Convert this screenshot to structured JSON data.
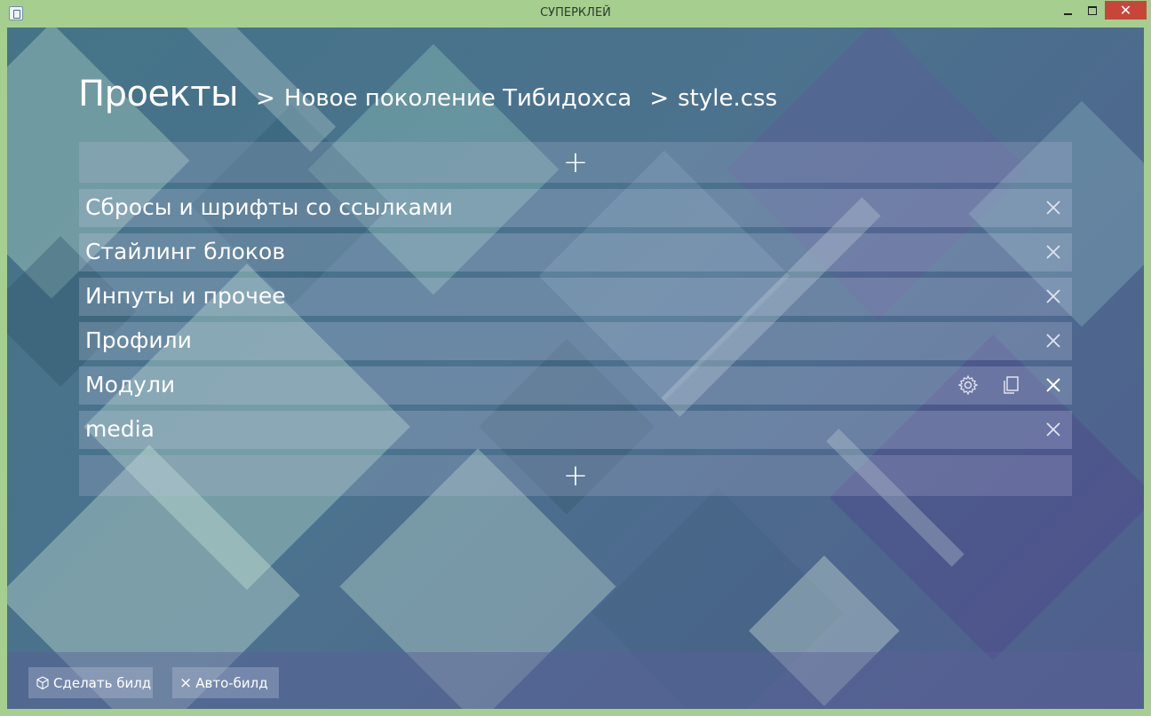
{
  "window": {
    "title": "СУПЕРКЛЕЙ",
    "close_glyph": "✕"
  },
  "breadcrumb": {
    "root": "Проекты",
    "separator": ">",
    "items": [
      "Новое поколение Тибидохса",
      "style.css"
    ]
  },
  "add_glyph": "+",
  "rows": [
    {
      "label": "Сбросы и шрифты со ссылками"
    },
    {
      "label": "Стайлинг блоков"
    },
    {
      "label": "Инпуты и прочее"
    },
    {
      "label": "Профили"
    },
    {
      "label": "Модули",
      "hovered": true
    },
    {
      "label": "media"
    }
  ],
  "footer": {
    "build_label": "Сделать билд",
    "autobuild_label": "Авто-билд",
    "autobuild_icon": "×"
  },
  "colors": {
    "frame": "#a6cf8f",
    "close_button": "#c7463a",
    "text": "#ffffff"
  },
  "icons": [
    "app-icon",
    "minimize-icon",
    "maximize-icon",
    "close-icon",
    "plus-icon",
    "gear-icon",
    "copy-icon",
    "cube-icon"
  ]
}
